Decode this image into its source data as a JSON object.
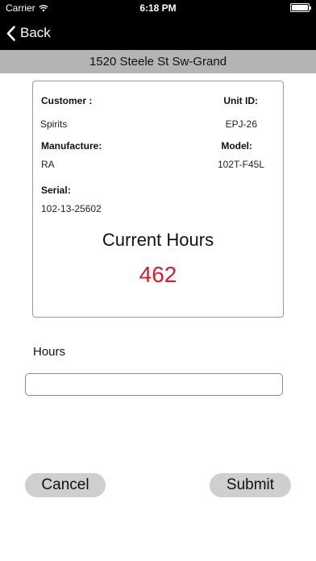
{
  "status_bar": {
    "carrier": "Carrier",
    "time": "6:18 PM"
  },
  "nav": {
    "back_label": "Back"
  },
  "address": "1520 Steele St Sw-Grand",
  "card": {
    "customer_label": "Customer :",
    "customer_value": "Spirits",
    "unit_id_label": "Unit ID:",
    "unit_id_value": "EPJ-26",
    "manufacture_label": "Manufacture:",
    "manufacture_value": "RA",
    "model_label": "Model:",
    "model_value": "102T-F45L",
    "serial_label": "Serial:",
    "serial_value": "102-13-25602",
    "current_hours_title": "Current Hours",
    "current_hours_value": "462"
  },
  "form": {
    "hours_label": "Hours",
    "hours_value": "",
    "hours_placeholder": ""
  },
  "buttons": {
    "cancel": "Cancel",
    "submit": "Submit"
  },
  "colors": {
    "accent_hours": "#d0202e",
    "header_bg": "#000000",
    "address_bg": "#b4b4b4",
    "button_bg": "#cfcfcf"
  }
}
